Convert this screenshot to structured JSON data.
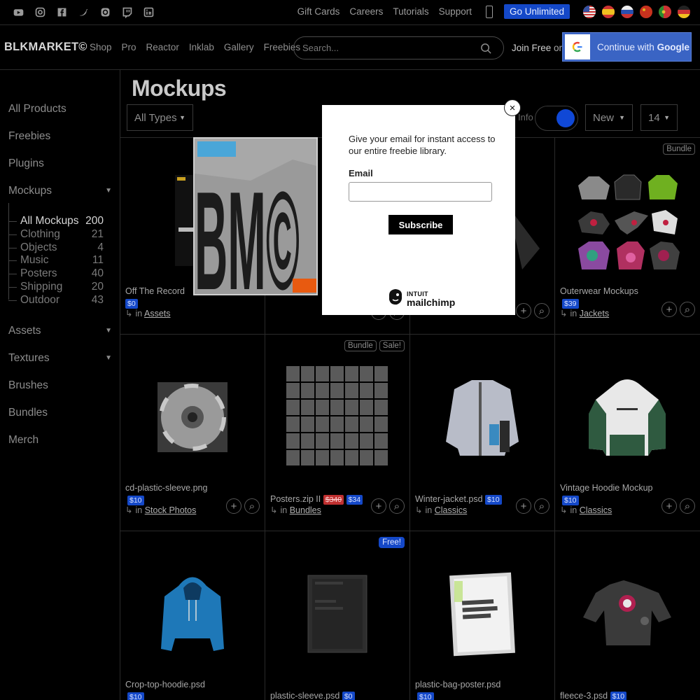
{
  "topbar": {
    "social_icons": [
      "youtube-icon",
      "instagram-icon",
      "facebook-icon",
      "twitter-icon",
      "pinterest-icon",
      "twitch-icon",
      "linkedin-icon"
    ],
    "links": [
      "Gift Cards",
      "Careers",
      "Tutorials",
      "Support"
    ],
    "cta": "Go Unlimited",
    "flags": [
      "us-flag",
      "es-flag",
      "ru-flag",
      "red-flag",
      "pt-flag",
      "de-flag"
    ]
  },
  "header": {
    "logo": "BLKMARKET©",
    "nav": [
      "Shop",
      "Pro",
      "Reactor",
      "Inklab",
      "Gallery",
      "Freebies"
    ],
    "search_placeholder": "Search...",
    "join_prefix": "Join Free",
    "join_or": " or",
    "google_label": "Continue with ",
    "google_brand": "Google"
  },
  "sidebar": {
    "items": [
      "All Products",
      "Freebies",
      "Plugins",
      "Mockups"
    ],
    "mockups_sub": [
      {
        "label": "All Mockups",
        "count": "200"
      },
      {
        "label": "Clothing",
        "count": "21"
      },
      {
        "label": "Objects",
        "count": "4"
      },
      {
        "label": "Music",
        "count": "11"
      },
      {
        "label": "Posters",
        "count": "40"
      },
      {
        "label": "Shipping",
        "count": "20"
      },
      {
        "label": "Outdoor",
        "count": "43"
      }
    ],
    "items_after": [
      "Assets",
      "Textures",
      "Brushes",
      "Bundles",
      "Merch"
    ]
  },
  "content": {
    "title": "Mockups",
    "type_filter": "All Types",
    "info_label": "Info",
    "sort": "New",
    "per_page": "14"
  },
  "cards": [
    {
      "name": "Off The Record",
      "price": "$0",
      "cat": "Assets",
      "badges": []
    },
    {
      "name": "",
      "price": "",
      "cat": "",
      "badges": []
    },
    {
      "name": "",
      "price": "",
      "cat": "",
      "badges": []
    },
    {
      "name": "Outerwear Mockups",
      "price": "$39",
      "cat": "Jackets",
      "badges": [
        "Bundle"
      ]
    },
    {
      "name": "cd-plastic-sleeve.png",
      "price": "$10",
      "cat": "Stock Photos",
      "badges": []
    },
    {
      "name": "Posters.zip II",
      "old_price": "$340",
      "price": "$34",
      "cat": "Bundles",
      "badges": [
        "Bundle",
        "Sale!"
      ]
    },
    {
      "name": "Winter-jacket.psd",
      "price": "$10",
      "cat": "Classics",
      "badges": []
    },
    {
      "name": "Vintage Hoodie Mockup",
      "price": "$10",
      "cat": "Classics",
      "badges": []
    },
    {
      "name": "Crop-top-hoodie.psd",
      "price": "$10",
      "cat": "",
      "badges": []
    },
    {
      "name": "plastic-sleeve.psd",
      "price": "$0",
      "cat": "",
      "badges": [
        "Free!"
      ]
    },
    {
      "name": "plastic-bag-poster.psd",
      "price": "$10",
      "cat": "",
      "badges": []
    },
    {
      "name": "fleece-3.psd",
      "price": "$10",
      "cat": "",
      "badges": []
    }
  ],
  "card_common": {
    "in_label": "in"
  },
  "promo": {
    "text": "BM©"
  },
  "modal": {
    "message": "Give your email for instant access to our entire freebie library.",
    "email_label": "Email",
    "subscribe": "Subscribe",
    "brand_top": "INTUIT",
    "brand_name": "mailchimp",
    "close": "×"
  },
  "colors": {
    "accent": "#1448c8",
    "sale": "#c03030",
    "background": "#000000"
  }
}
